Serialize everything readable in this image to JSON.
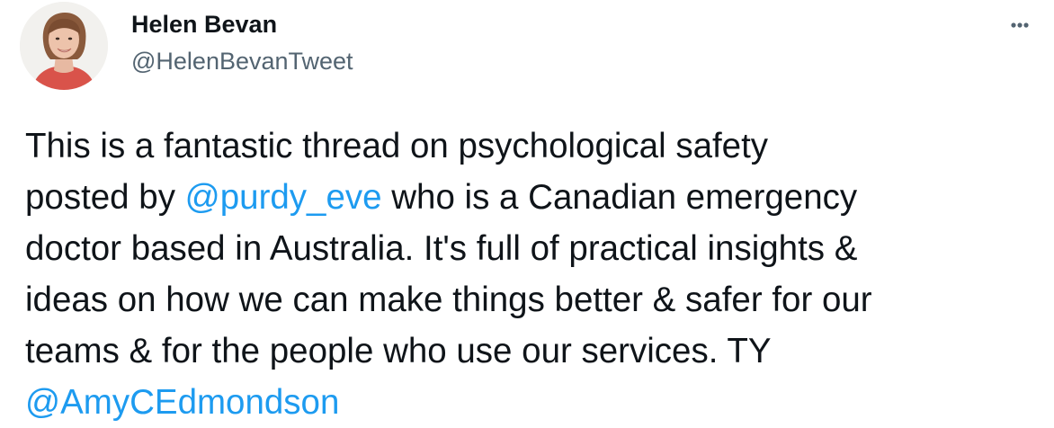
{
  "author": {
    "name": "Helen Bevan",
    "handle": "@HelenBevanTweet"
  },
  "tweet": {
    "line1": "This is a fantastic thread on psychological safety",
    "line2_before": "posted by ",
    "mention1": "@purdy_eve",
    "line2_after": " who is a Canadian emergency",
    "line3": "doctor based in Australia. It's full of practical insights &",
    "line4": "ideas on how we can make things better & safer for our",
    "line5": "teams & for the people who use our services. TY",
    "mention2": "@AmyCEdmondson"
  },
  "icons": {
    "more": "more-options-icon",
    "avatar": "profile-photo"
  },
  "colors": {
    "text": "#0f1419",
    "secondary": "#536471",
    "link": "#1d9bf0",
    "background": "#ffffff"
  }
}
